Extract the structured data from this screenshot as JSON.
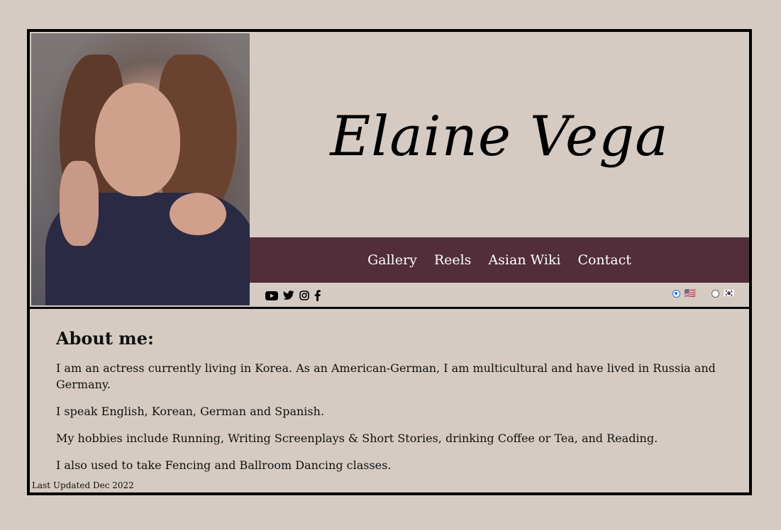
{
  "header": {
    "name": "Elaine Vega"
  },
  "nav": {
    "items": [
      "Gallery",
      "Reels",
      "Asian Wiki",
      "Contact"
    ]
  },
  "social": {
    "icons": [
      "youtube-icon",
      "twitter-icon",
      "instagram-icon",
      "facebook-icon"
    ]
  },
  "language": {
    "options": [
      {
        "flag": "🇺🇸",
        "selected": true
      },
      {
        "flag": "🇰🇷",
        "selected": false
      }
    ]
  },
  "about": {
    "heading": "About me:",
    "paragraphs": [
      "I am an actress currently living in Korea. As an American-German, I am multicultural and have lived in Russia and Germany.",
      "I speak English, Korean, German and Spanish.",
      "My hobbies include Running, Writing Screenplays & Short Stories, drinking Coffee or Tea, and Reading.",
      "I also used to take Fencing and Ballroom Dancing classes."
    ]
  },
  "footer": {
    "text": "Last Updated Dec 2022"
  },
  "colors": {
    "background": "#d5cbc2",
    "nav": "#512e3a",
    "border": "#000000"
  }
}
